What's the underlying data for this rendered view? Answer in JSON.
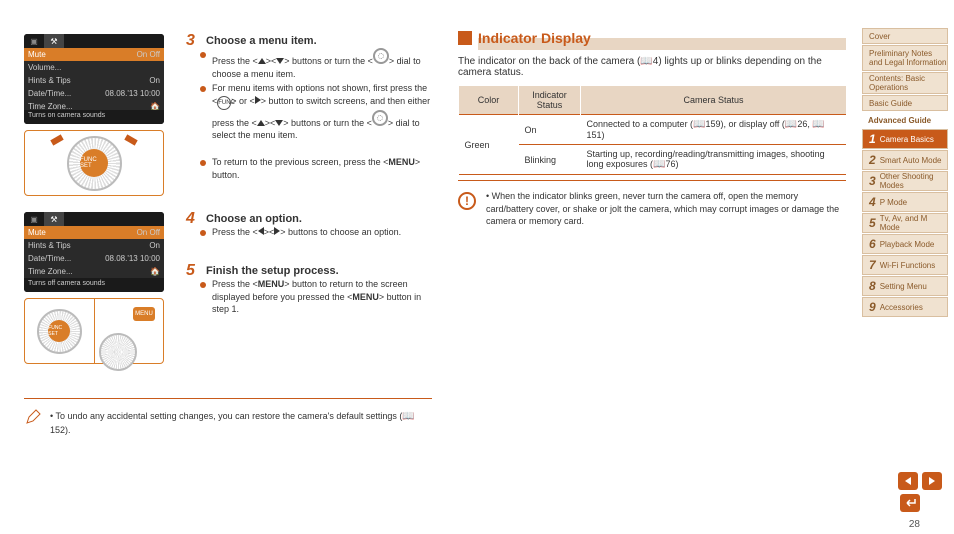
{
  "screen1": {
    "rows": [
      {
        "label": "Mute",
        "val": "On Off",
        "hl": true
      },
      {
        "label": "Volume...",
        "val": ""
      },
      {
        "label": "Hints & Tips",
        "val": "On"
      },
      {
        "label": "Date/Time...",
        "val": "08.08.'13 10:00"
      },
      {
        "label": "Time Zone...",
        "val": "🏠"
      }
    ],
    "footer": "Turns on camera sounds"
  },
  "screen2": {
    "rows": [
      {
        "label": "Mute",
        "val": "On Off",
        "hl": true
      },
      {
        "label": "Hints & Tips",
        "val": "On"
      },
      {
        "label": "Date/Time...",
        "val": "08.08.'13 10:00"
      },
      {
        "label": "Time Zone...",
        "val": "🏠"
      }
    ],
    "footer": "Turns off camera sounds"
  },
  "dial_center": "FUNC SET",
  "steps": {
    "s3": {
      "num": "3",
      "title": "Choose a menu item."
    },
    "s3b1": "Press the <▲><▼> buttons or turn the <●> dial to choose a menu item.",
    "s3b2a": "For menu items with options not shown, first press the <",
    "s3b2b": "> or <▶> button to switch screens, and then either press the <▲><▼> buttons or turn the <●> dial to select the menu item.",
    "s3b3": "To return to the previous screen, press the <MENU> button.",
    "s4": {
      "num": "4",
      "title": "Choose an option."
    },
    "s4b1": "Press the <◀><▶> buttons to choose an option.",
    "s5": {
      "num": "5",
      "title": "Finish the setup process."
    },
    "s5b1": "Press the <MENU> button to return to the screen displayed before you pressed the <MENU> button in step 1."
  },
  "note": {
    "text1": "To undo any accidental setting changes, you can restore the camera's default settings (",
    "ref": "152",
    "text2": ")."
  },
  "right": {
    "heading": "Indicator Display",
    "intro1": "The indicator on the back of the camera (",
    "intro_ref": "4",
    "intro2": ") lights up or blinks depending on the camera status.",
    "th1": "Color",
    "th2": "Indicator Status",
    "th3": "Camera Status",
    "row1": {
      "c": "Green",
      "s": "On",
      "d1": "Connected to a computer (",
      "r1": "159",
      "d2": "), or display off (",
      "r2": "151",
      "d3": ")",
      "r3": "26"
    },
    "row2": {
      "s": "Blinking",
      "d1": "Starting up, recording/reading/transmitting images, shooting long exposures (",
      "r1": "76",
      "d2": ")"
    },
    "warn": "When the indicator blinks green, never turn the camera off, open the memory card/battery cover, or shake or jolt the camera, which may corrupt images or damage the camera or memory card."
  },
  "nav": {
    "items": [
      "Cover",
      "Preliminary Notes and Legal Information",
      "Contents: Basic Operations",
      "Basic Guide",
      "Advanced Guide"
    ],
    "chapters": [
      {
        "n": "1",
        "t": "Camera Basics"
      },
      {
        "n": "2",
        "t": "Smart Auto Mode"
      },
      {
        "n": "3",
        "t": "Other Shooting Modes"
      },
      {
        "n": "4",
        "t": "P Mode"
      },
      {
        "n": "5",
        "t": "Tv, Av, and M Mode"
      },
      {
        "n": "6",
        "t": "Playback Mode"
      },
      {
        "n": "7",
        "t": "Wi-Fi Functions"
      },
      {
        "n": "8",
        "t": "Setting Menu"
      },
      {
        "n": "9",
        "t": "Accessories"
      }
    ]
  },
  "page": "28"
}
